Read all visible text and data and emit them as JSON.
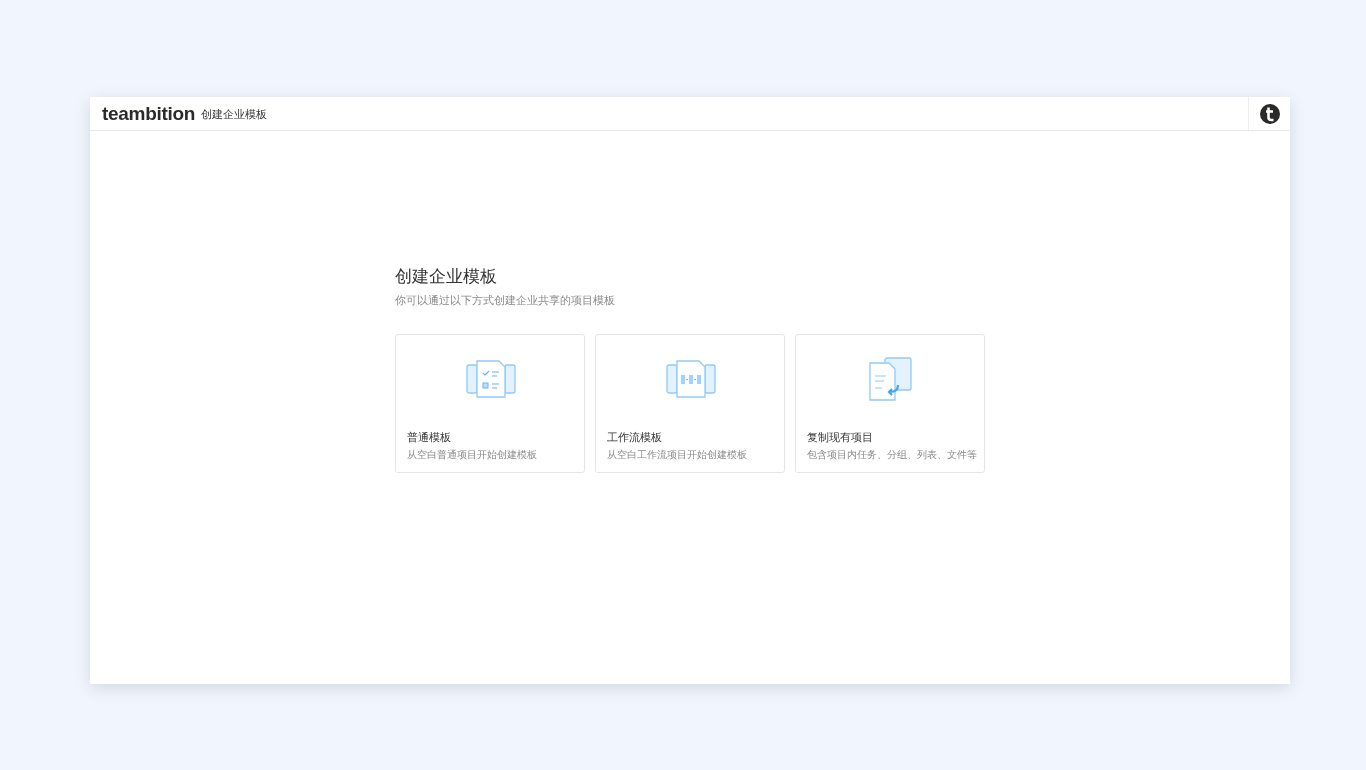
{
  "header": {
    "logo": "teambition",
    "title": "创建企业模板"
  },
  "main": {
    "title": "创建企业模板",
    "subtitle": "你可以通过以下方式创建企业共享的项目模板"
  },
  "cards": [
    {
      "kind": "normal",
      "title": "普通模板",
      "description": "从空白普通项目开始创建模板"
    },
    {
      "kind": "workflow",
      "title": "工作流模板",
      "description": "从空白工作流项目开始创建模板"
    },
    {
      "kind": "copy",
      "title": "复制现有项目",
      "description": "包含项目内任务、分组、列表、文件等"
    }
  ]
}
